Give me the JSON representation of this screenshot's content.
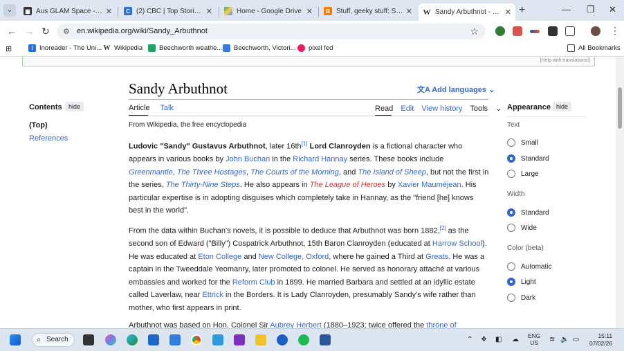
{
  "browser": {
    "tabs": [
      {
        "title": "Aus GLAM Space - Home",
        "favicon": "aus-glam-icon",
        "color": "#333333",
        "active": false
      },
      {
        "title": "(2) CBC | Top Stories New",
        "favicon": "cbc-icon",
        "color": "#2f6fd6",
        "active": false
      },
      {
        "title": "Home - Google Drive",
        "favicon": "google-drive-icon",
        "color": "#1fa463",
        "active": false
      },
      {
        "title": "Stuff, geeky stuff: Search",
        "favicon": "blogger-icon",
        "color": "#f57d00",
        "active": false
      },
      {
        "title": "Sandy Arbuthnot - Wikip",
        "favicon": "wikipedia-icon",
        "color": "#555555",
        "active": true
      }
    ],
    "url": "en.wikipedia.org/wiki/Sandy_Arbuthnot",
    "bookmarks": [
      {
        "label": "Inoreader - The Uni...",
        "color": "#1a73e8"
      },
      {
        "label": "Wikipedia",
        "color": "#333333"
      },
      {
        "label": "Beechworth weathe...",
        "color": "#1fa463"
      },
      {
        "label": "Beechworth, Victori...",
        "color": "#3a7bd5"
      },
      {
        "label": "pixel fed",
        "color": "#e91e63"
      }
    ],
    "all_bookmarks": "All Bookmarks"
  },
  "article": {
    "title": "Sandy Arbuthnot",
    "add_languages": "Add languages",
    "tabs_left": [
      "Article",
      "Talk"
    ],
    "tabs_right": [
      "Read",
      "Edit",
      "View history",
      "Tools"
    ],
    "from": "From Wikipedia, the free encyclopedia",
    "banner_right": "[Help with translations!]"
  },
  "toc": {
    "heading": "Contents",
    "hide": "hide",
    "items": [
      "(Top)",
      "References"
    ]
  },
  "appearance": {
    "heading": "Appearance",
    "hide": "hide",
    "text_label": "Text",
    "text_options": [
      "Small",
      "Standard",
      "Large"
    ],
    "text_selected": "Standard",
    "width_label": "Width",
    "width_options": [
      "Standard",
      "Wide"
    ],
    "width_selected": "Standard",
    "color_label": "Color (beta)",
    "color_options": [
      "Automatic",
      "Light",
      "Dark"
    ],
    "color_selected": "Light"
  },
  "taskbar": {
    "search": "Search",
    "lang_line1": "ENG",
    "lang_line2": "US",
    "time": "15:11",
    "date": "07/02/26"
  }
}
